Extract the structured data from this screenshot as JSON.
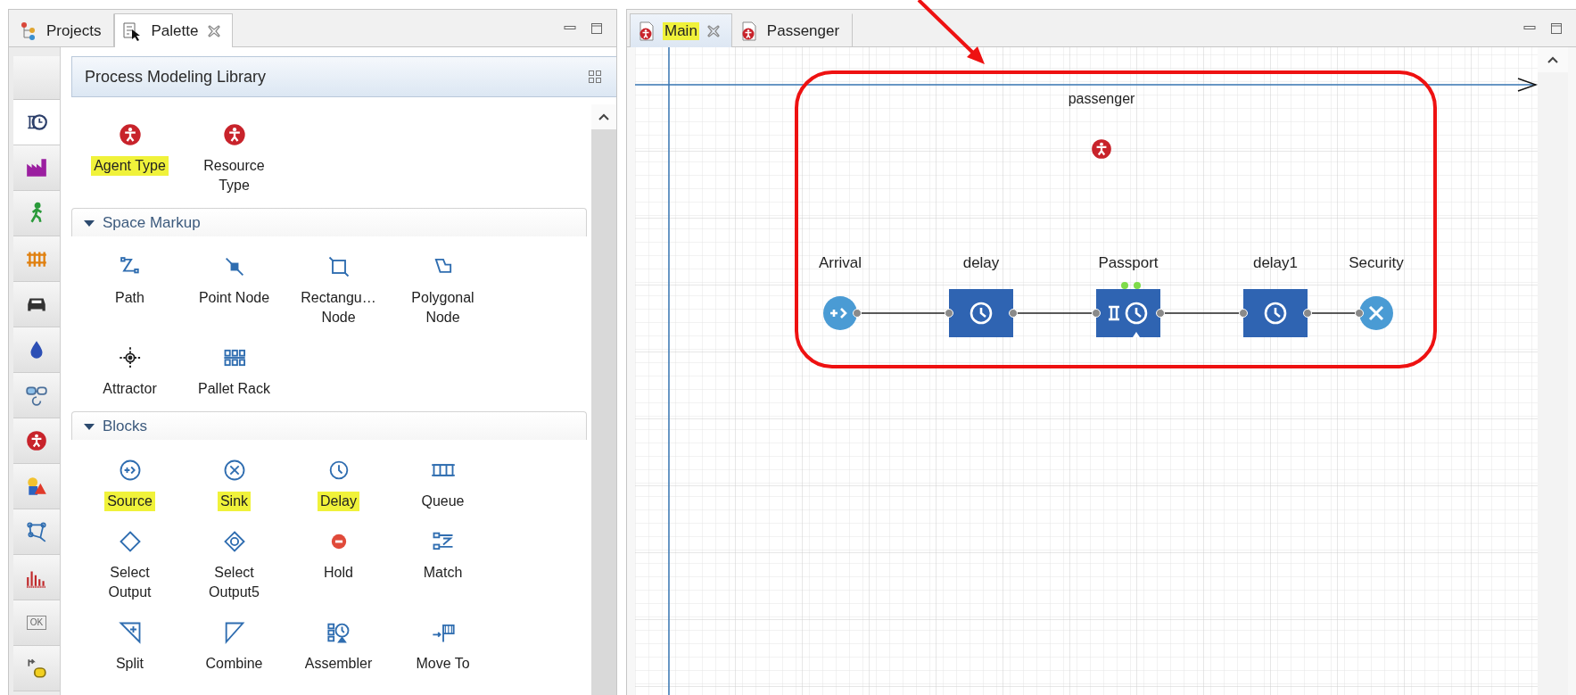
{
  "left_panel": {
    "tabs": [
      {
        "label": "Projects",
        "selected": false,
        "closable": false
      },
      {
        "label": "Palette",
        "selected": true,
        "closable": true
      }
    ],
    "palette_categories": [
      {
        "selected": true
      },
      {
        "selected": false
      },
      {
        "selected": false
      },
      {
        "selected": false
      },
      {
        "selected": false
      },
      {
        "selected": false
      },
      {
        "selected": false
      },
      {
        "selected": false
      },
      {
        "selected": false
      },
      {
        "selected": false
      },
      {
        "selected": false
      },
      {
        "selected": false,
        "label": "OK"
      },
      {
        "selected": false
      }
    ],
    "library_title": "Process Modeling Library",
    "sections": [
      {
        "items": [
          {
            "label": "Agent Type",
            "highlighted": true
          },
          {
            "label": "Resource\nType",
            "highlighted": false
          }
        ]
      },
      {
        "title": "Space Markup",
        "expanded": true,
        "items": [
          {
            "label": "Path",
            "highlighted": false
          },
          {
            "label": "Point Node",
            "highlighted": false
          },
          {
            "label": "Rectangu…\nNode",
            "highlighted": false
          },
          {
            "label": "Polygonal\nNode",
            "highlighted": false
          },
          {
            "label": "Attractor",
            "highlighted": false
          },
          {
            "label": "Pallet Rack",
            "highlighted": false
          }
        ]
      },
      {
        "title": "Blocks",
        "expanded": true,
        "items": [
          {
            "label": "Source",
            "highlighted": true
          },
          {
            "label": "Sink",
            "highlighted": true
          },
          {
            "label": "Delay",
            "highlighted": true
          },
          {
            "label": "Queue",
            "highlighted": false
          },
          {
            "label": "Select\nOutput",
            "highlighted": false
          },
          {
            "label": "Select\nOutput5",
            "highlighted": false
          },
          {
            "label": "Hold",
            "highlighted": false
          },
          {
            "label": "Match",
            "highlighted": false
          },
          {
            "label": "Split",
            "highlighted": false
          },
          {
            "label": "Combine",
            "highlighted": false
          },
          {
            "label": "Assembler",
            "highlighted": false
          },
          {
            "label": "Move To",
            "highlighted": false
          }
        ]
      }
    ]
  },
  "editor": {
    "tabs": [
      {
        "label": "Main",
        "selected": true,
        "highlighted": true,
        "closable": true
      },
      {
        "label": "Passenger",
        "selected": false,
        "highlighted": false,
        "closable": false
      }
    ],
    "diagram": {
      "agent": {
        "label": "passenger"
      },
      "blocks": [
        {
          "label": "Arrival",
          "kind": "source"
        },
        {
          "label": "delay",
          "kind": "delay"
        },
        {
          "label": "Passport",
          "kind": "service"
        },
        {
          "label": "delay1",
          "kind": "delay"
        },
        {
          "label": "Security",
          "kind": "sink"
        }
      ]
    }
  }
}
